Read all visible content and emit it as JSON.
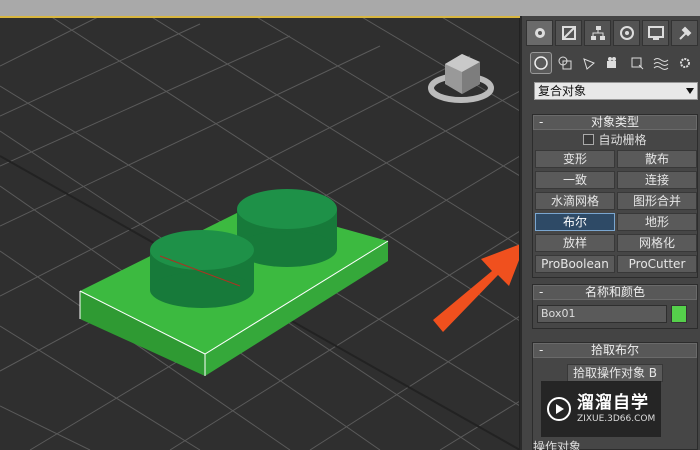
{
  "panel": {
    "dropdown_value": "复合对象",
    "object_type": {
      "title": "对象类型",
      "auto_grid_label": "自动栅格",
      "buttons": [
        "变形",
        "散布",
        "一致",
        "连接",
        "水滴网格",
        "图形合并",
        "布尔",
        "地形",
        "放样",
        "网格化",
        "ProBoolean",
        "ProCutter"
      ],
      "active_button": "布尔"
    },
    "name_color": {
      "title": "名称和颜色",
      "name_value": "Box01",
      "color": "#55d04b"
    },
    "pick_boolean": {
      "title": "拾取布尔",
      "pick_button_label": "拾取操作对象 B"
    },
    "operands_label": "操作对象"
  },
  "watermark": {
    "title": "溜溜自学",
    "url": "ZIXUE.3D66.COM"
  },
  "colors": {
    "box_green": "#3cba40",
    "cylinder_green": "#1e8a45",
    "arrow_orange": "#f0501e",
    "active_blue": "#2e4a66"
  },
  "icons": [
    "create-icon",
    "modify-icon",
    "hierarchy-icon",
    "motion-icon",
    "display-icon",
    "utilities-icon",
    "geometry-icon",
    "shapes-icon",
    "lights-icon",
    "cameras-icon",
    "helpers-icon",
    "spacewarps-icon",
    "systems-icon"
  ]
}
